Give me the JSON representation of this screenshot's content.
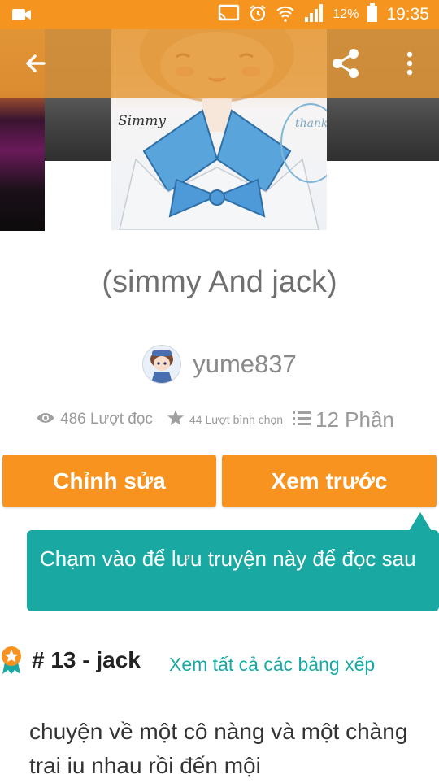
{
  "status_bar": {
    "battery_percent": "12%",
    "time": "19:35",
    "icons": [
      "video-camera-icon",
      "cast-icon",
      "alarm-icon",
      "wifi-icon",
      "signal-icon",
      "battery-icon"
    ]
  },
  "app_bar": {
    "icons": [
      "back-arrow-icon",
      "share-icon",
      "more-vert-icon"
    ]
  },
  "cover": {
    "handwritten_label": "Simmy",
    "handwritten_note": "thank you"
  },
  "story": {
    "title": "(simmy And jack)",
    "author": "yume837"
  },
  "stats": {
    "reads": "486 Lượt đọc",
    "votes": "44 Lượt bình chọn",
    "parts": "12 Phần"
  },
  "buttons": {
    "edit": "Chỉnh sửa",
    "preview": "Xem trước"
  },
  "tooltip": {
    "text": "Chạm vào để lưu truyện này để đọc sau"
  },
  "ranking": {
    "rank": "# 13 - jack",
    "link": "Xem tất cả các bảng xếp"
  },
  "description": {
    "text": "chuyện về một cô nàng và một chàng trai iu nhau rồi đến mội"
  },
  "colors": {
    "status_bar": "#f5941e",
    "accent_orange": "#f7931e",
    "teal": "#1aa8a3",
    "title_gray": "#6f6f6f"
  }
}
